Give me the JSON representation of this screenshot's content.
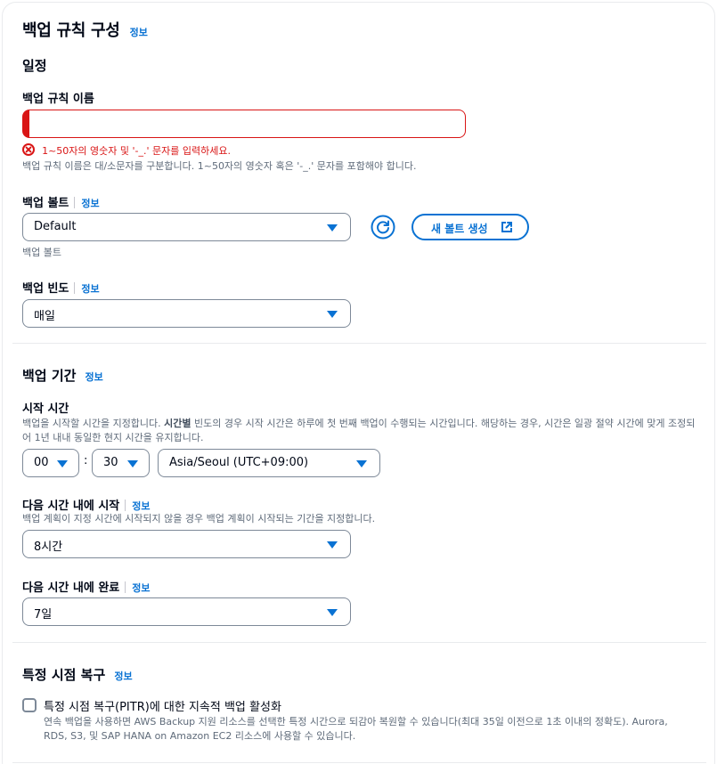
{
  "header": {
    "title": "백업 규칙 구성",
    "info": "정보"
  },
  "schedule": {
    "title": "일정",
    "rule_name": {
      "label": "백업 규칙 이름",
      "value": "",
      "error": "1~50자의 영숫자 및 '-_.' 문자를 입력하세요.",
      "hint": "백업 규칙 이름은 대/소문자를 구분합니다. 1~50자의 영숫자 혹은 '-_.' 문자를 포함해야 합니다."
    },
    "vault": {
      "label": "백업 볼트",
      "info": "정보",
      "value": "Default",
      "refresh_icon": "refresh-icon",
      "create_button": "새 볼트 생성",
      "external_icon": "external-link-icon",
      "hint": "백업 볼트"
    },
    "frequency": {
      "label": "백업 빈도",
      "info": "정보",
      "value": "매일"
    }
  },
  "window": {
    "title": "백업 기간",
    "info": "정보",
    "start_time": {
      "label": "시작 시간",
      "desc_1": "백업을 시작할 시간을 지정합니다. ",
      "desc_bold": "시간별",
      "desc_2": " 빈도의 경우 시작 시간은 하루에 첫 번째 백업이 수행되는 시간입니다. 해당하는 경우, 시간은 일광 절약 시간에 맞게 조정되어 1년 내내 동일한 현지 시간을 유지합니다.",
      "hour": "00",
      "separator": ":",
      "minute": "30",
      "timezone": "Asia/Seoul (UTC+09:00)"
    },
    "start_within": {
      "label": "다음 시간 내에 시작",
      "info": "정보",
      "desc": "백업 계획이 지정 시간에 시작되지 않을 경우 백업 계획이 시작되는 기간을 지정합니다.",
      "value": "8시간"
    },
    "complete_within": {
      "label": "다음 시간 내에 완료",
      "info": "정보",
      "value": "7일"
    }
  },
  "pitr": {
    "title": "특정 시점 복구",
    "info": "정보",
    "checkbox_label": "특정 시점 복구(PITR)에 대한 지속적 백업 활성화",
    "checked": false,
    "desc": "연속 백업을 사용하면 AWS Backup 지원 리소스를 선택한 특정 시간으로 되감아 복원할 수 있습니다(최대 35일 이전으로 1초 이내의 정확도). Aurora, RDS, S3, 및 SAP HANA on Amazon EC2 리소스에 사용할 수 있습니다."
  },
  "colors": {
    "accent": "#0972d3",
    "error": "#d91515",
    "text": "#000716",
    "muted": "#5f6b7a",
    "border": "#7d8998"
  }
}
